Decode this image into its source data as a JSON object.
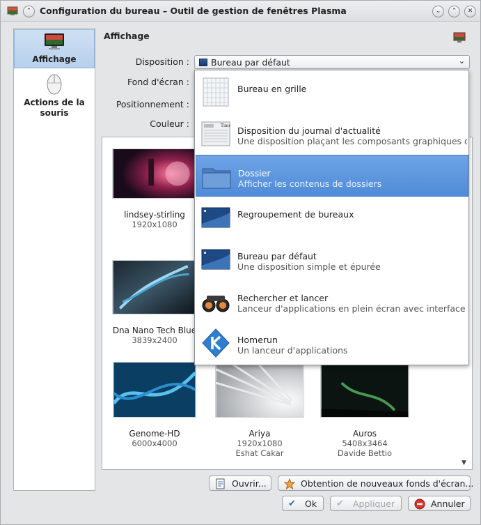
{
  "window": {
    "title": "Configuration du bureau – Outil de gestion de fenêtres Plasma"
  },
  "sidebar": {
    "items": [
      {
        "label": "Affichage"
      },
      {
        "label": "Actions de la souris"
      }
    ]
  },
  "page": {
    "title": "Affichage",
    "labels": {
      "disposition": "Disposition :",
      "fond": "Fond d'écran :",
      "positionnement": "Positionnement :",
      "couleur": "Couleur :"
    },
    "disposition_value": "Bureau par défaut"
  },
  "dropdown": {
    "options": [
      {
        "title": "Bureau en grille",
        "desc": ""
      },
      {
        "title": "Disposition du journal d'actualité",
        "desc": "Une disposition plaçant les composants graphiques dar"
      },
      {
        "title": "Dossier",
        "desc": "Afficher les contenus de dossiers",
        "selected": true
      },
      {
        "title": "Regroupement de bureaux",
        "desc": ""
      },
      {
        "title": "Bureau par défaut",
        "desc": "Une disposition simple et épurée"
      },
      {
        "title": "Rechercher et lancer",
        "desc": "Lanceur d'applications en plein écran avec interface de r"
      },
      {
        "title": "Homerun",
        "desc": "Un lanceur d'applications"
      }
    ]
  },
  "wallpapers": [
    {
      "name": "lindsey-stirling",
      "size": "1920x1080",
      "author": ""
    },
    {
      "name": "Dna Nano Tech Blue",
      "size": "3839x2400",
      "author": ""
    },
    {
      "name": "Genome-HD",
      "size": "6000x4000",
      "author": ""
    },
    {
      "name": "Ariya",
      "size": "1920x1080",
      "author": "Eshat Cakar"
    },
    {
      "name": "Auros",
      "size": "5408x3464",
      "author": "Davide Bettio"
    }
  ],
  "buttons": {
    "open": "Ouvrir...",
    "get_new": "Obtention de nouveaux fonds d'écran...",
    "ok": "Ok",
    "apply": "Appliquer",
    "cancel": "Annuler"
  }
}
